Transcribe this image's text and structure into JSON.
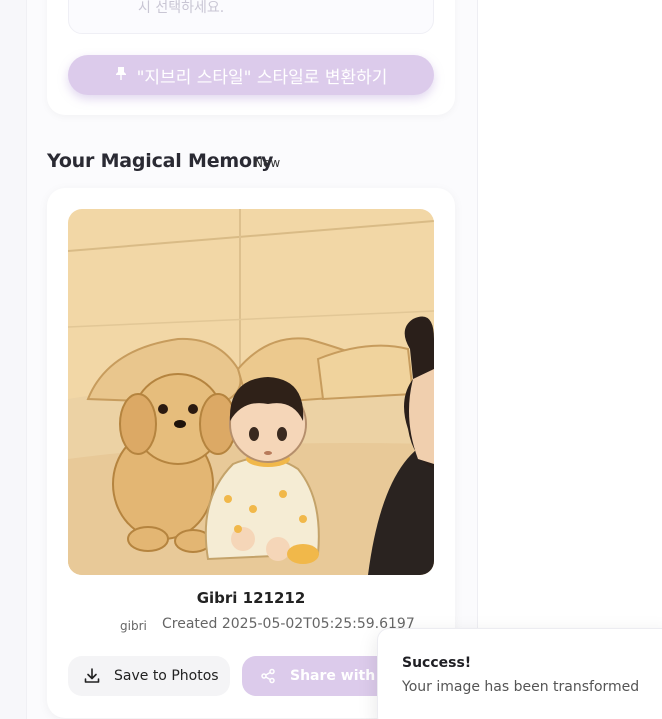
{
  "transform": {
    "hint_text": "시 선택하세요.",
    "convert_icon": "pin-icon",
    "convert_label": "\"지브리 스타일\" 스타일로 변환하기"
  },
  "memory": {
    "section_title": "Your Magical Memory",
    "badge": "New",
    "image_title": "Gibri 121212",
    "author": "gibri",
    "created": "Created 2025-05-02T05:25:59.6197",
    "save_label": "Save to Photos",
    "share_label": "Share with Fa"
  },
  "toast": {
    "title": "Success!",
    "message": "Your image has been transformed"
  },
  "colors": {
    "accent": "#dccbeb",
    "background": "#fbfbfd"
  }
}
